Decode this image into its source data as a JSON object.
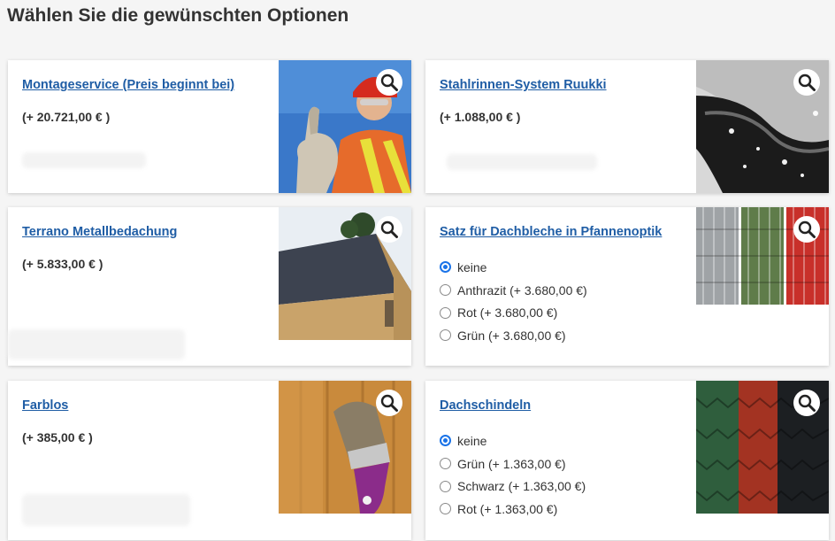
{
  "page": {
    "title": "Wählen Sie die gewünschten Optionen"
  },
  "options": [
    {
      "title": "Montageservice (Preis beginnt bei)",
      "price": "(+ 20.721,00 € )"
    },
    {
      "title": "Stahlrinnen-System Ruukki",
      "price": "(+ 1.088,00 € )"
    },
    {
      "title": "Terrano Metallbedachung",
      "price": "(+ 5.833,00 € )"
    },
    {
      "title": "Satz für Dachbleche in Pfannenoptik",
      "choices": [
        "keine",
        "Anthrazit (+ 3.680,00 €)",
        "Rot (+ 3.680,00 €)",
        "Grün (+ 3.680,00 €)"
      ],
      "selected": "keine"
    },
    {
      "title": "Farblos",
      "price": "(+ 385,00 € )"
    },
    {
      "title": "Dachschindeln",
      "choices": [
        "keine",
        "Grün (+ 1.363,00 €)",
        "Schwarz (+ 1.363,00 €)",
        "Rot (+ 1.363,00 €)"
      ],
      "selected": "keine"
    }
  ],
  "icons": {
    "zoom": "magnifier-icon"
  },
  "colors": {
    "link": "#1f5da5",
    "radio_checked": "#1a73e8"
  }
}
